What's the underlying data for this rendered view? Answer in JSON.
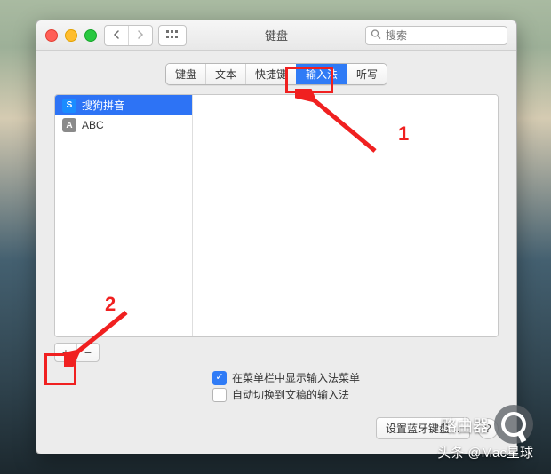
{
  "window": {
    "title": "键盘",
    "search_placeholder": "搜索"
  },
  "tabs": {
    "items": [
      {
        "label": "键盘",
        "active": false
      },
      {
        "label": "文本",
        "active": false
      },
      {
        "label": "快捷键",
        "active": false
      },
      {
        "label": "输入法",
        "active": true
      },
      {
        "label": "听写",
        "active": false
      }
    ]
  },
  "sources": {
    "items": [
      {
        "label": "搜狗拼音",
        "icon": "S",
        "icon_class": "sogou",
        "selected": true
      },
      {
        "label": "ABC",
        "icon": "A",
        "icon_class": "abc",
        "selected": false
      }
    ]
  },
  "buttons": {
    "add": "+",
    "remove": "−",
    "bluetooth": "设置蓝牙键盘…",
    "help": "?"
  },
  "options": {
    "show_menu": {
      "label": "在菜单栏中显示输入法菜单",
      "checked": true
    },
    "auto_switch": {
      "label": "自动切换到文稿的输入法",
      "checked": false
    }
  },
  "annotations": {
    "label1": "1",
    "label2": "2"
  },
  "watermark": {
    "brand": "路由器",
    "byline": "头条 @Mac星球"
  }
}
